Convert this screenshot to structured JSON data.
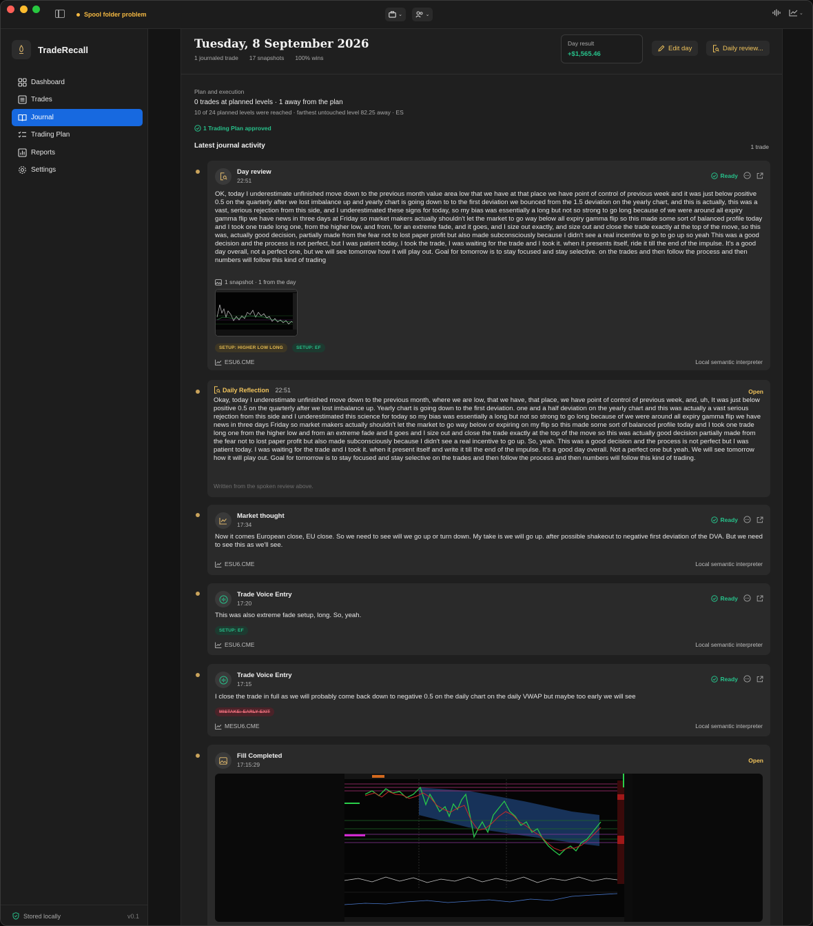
{
  "window": {
    "warning": "Spool folder problem"
  },
  "sidebar": {
    "app_name": "TradeRecall",
    "items": [
      {
        "label": "Dashboard",
        "icon": "grid-icon",
        "active": false
      },
      {
        "label": "Trades",
        "icon": "list-icon",
        "active": false
      },
      {
        "label": "Journal",
        "icon": "book-icon",
        "active": true
      },
      {
        "label": "Trading Plan",
        "icon": "checklist-icon",
        "active": false
      },
      {
        "label": "Reports",
        "icon": "bar-chart-icon",
        "active": false
      },
      {
        "label": "Settings",
        "icon": "gear-icon",
        "active": false
      }
    ],
    "footer_status": "Stored locally",
    "version": "v0.1"
  },
  "header": {
    "title": "Tuesday, 8 September 2026",
    "meta": [
      "1 journaled trade",
      "17 snapshots",
      "100% wins"
    ],
    "day_result_label": "Day result",
    "day_result_value": "+$1,565.46",
    "edit_day": "Edit day",
    "daily_review": "Daily review..."
  },
  "plan": {
    "label": "Plan and execution",
    "summary": "0 trades at planned levels · 1 away from the plan",
    "detail": "10 of 24 planned levels were reached · farthest untouched level 82.25 away · ES",
    "approved": "1 Trading Plan approved"
  },
  "activity": {
    "title": "Latest journal activity",
    "count": "1 trade",
    "entries": [
      {
        "title": "Day review",
        "time": "22:51",
        "status": "Ready",
        "body": "OK, today I underestimate unfinished move down to the previous month value area low that we have at that place we have point of control of previous week and it was just below positive 0.5 on the quarterly after we lost imbalance up and yearly chart is going down to to the first deviation we bounced from the 1.5 deviation on the yearly chart, and this is actually, this was a vast, serious rejection from this side, and I underestimated these signs for today, so my bias was essentially a long but not so strong to go long because of we were around all expiry gamma flip we have news in three days at Friday so market makers actually shouldn't let the market to go way below all expiry gamma flip so this made some sort of balanced profile today and I took one trade long one, from the higher low, and from, for an extreme fade, and it goes, and I size out exactly, and size out and close the trade exactly at the top of the move, so this was, actually good decision, partially made from the fear not to lost paper profit but also made subconsciously because I didn't see a real incentive to go to go up so yeah This was a good decision and the process is not perfect, but I was patient today, I took the trade, I was waiting for the trade and I took it. when it presents itself, ride it till the end of the impulse. It's a good day overall, not a perfect one, but we will see tomorrow how it will play out. Goal for tomorrow is to stay focused and stay selective. on the trades and then follow the process and then numbers will follow this kind of trading",
        "snapshot_label": "1 snapshot · 1 from the day",
        "tags": [
          "SETUP: HIGHER LOW LONG",
          "SETUP: EF"
        ],
        "symbol": "ESU6.CME",
        "interpreter": "Local semantic interpreter"
      },
      {
        "title": "Daily Reflection",
        "time": "22:51",
        "status": "Open",
        "body": "Okay, today I underestimate unfinished move down to the previous month, where we are low, that we have, that place, we have point of control of previous week, and, uh, It was just below positive 0.5 on the quarterly after we lost imbalance up. Yearly chart is going down to the first deviation. one and a half deviation on the yearly chart and this was actually a vast serious rejection from this side and I underestimated this science for today so my bias was essentially a long but not so strong to go long because of we were around all expiry gamma flip we have news in three days Friday so market makers actually shouldn't let the market to go way below or expiring on my flip so this made some sort of balanced profile today and I took one trade long one from the higher low and from an extreme fade and it goes and I size out and close the trade exactly at the top of the move so this was actually good decision partially made from the fear not to lost paper profit but also made subconsciously because I didn't see a real incentive to go up. So, yeah. This was a good decision and the process is not perfect but I was patient today. I was waiting for the trade and I took it. when it present itself and write it till the end of the impulse. It's a good day overall. Not a perfect one but yeah. We will see tomorrow how it will play out. Goal for tomorrow is to stay focused and stay selective on the trades and then follow the process and then numbers will follow this kind of trading.",
        "note": "Written from the spoken review above."
      },
      {
        "title": "Market thought",
        "time": "17:34",
        "status": "Ready",
        "body": "Now it comes European close, EU close. So we need to see will we go up or turn down. My take is we will go up. after possible shakeout to negative first deviation of the DVA. But we need to see this as we'll see.",
        "symbol": "ESU6.CME",
        "interpreter": "Local semantic interpreter"
      },
      {
        "title": "Trade Voice Entry",
        "time": "17:20",
        "status": "Ready",
        "body": "This was also extreme fade setup, long. So, yeah.",
        "tags": [
          "SETUP: EF"
        ],
        "symbol": "ESU6.CME",
        "interpreter": "Local semantic interpreter"
      },
      {
        "title": "Trade Voice Entry",
        "time": "17:15",
        "status": "Ready",
        "body": "I close the trade in full as we will probably come back down to negative 0.5 on the daily chart on the daily VWAP but maybe too early we will see",
        "tags": [
          "MISTAKE: EARLY EXIT"
        ],
        "symbol": "MESU6.CME",
        "interpreter": "Local semantic interpreter"
      },
      {
        "title": "Fill Completed",
        "time": "17:15:29",
        "status": "Open"
      }
    ]
  },
  "colors": {
    "accent": "#1769e0",
    "positive": "#27c08a",
    "warning": "#f0c35b",
    "mistake": "#e66b78"
  }
}
